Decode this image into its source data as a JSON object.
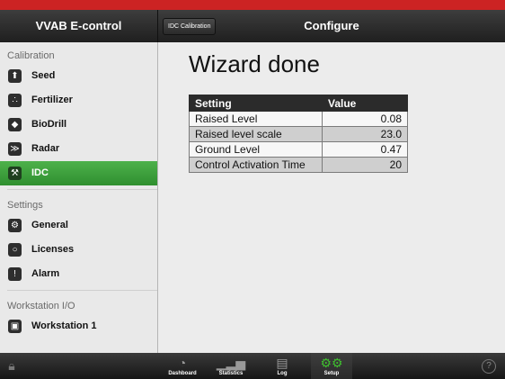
{
  "header": {
    "app_title": "VVAB E-control",
    "back_button": "IDC Calibration",
    "page_title": "Configure"
  },
  "sidebar": {
    "sections": [
      {
        "title": "Calibration",
        "items": [
          {
            "label": "Seed",
            "icon": "seed-icon",
            "active": false
          },
          {
            "label": "Fertilizer",
            "icon": "fertilizer-icon",
            "active": false
          },
          {
            "label": "BioDrill",
            "icon": "biodrill-icon",
            "active": false
          },
          {
            "label": "Radar",
            "icon": "radar-icon",
            "active": false
          },
          {
            "label": "IDC",
            "icon": "idc-icon",
            "active": true
          }
        ]
      },
      {
        "title": "Settings",
        "items": [
          {
            "label": "General",
            "icon": "general-icon",
            "active": false
          },
          {
            "label": "Licenses",
            "icon": "licenses-icon",
            "active": false
          },
          {
            "label": "Alarm",
            "icon": "alarm-icon",
            "active": false
          }
        ]
      },
      {
        "title": "Workstation I/O",
        "items": [
          {
            "label": "Workstation 1",
            "icon": "workstation-icon",
            "active": false
          }
        ]
      }
    ]
  },
  "main": {
    "heading": "Wizard done",
    "table": {
      "columns": [
        "Setting",
        "Value"
      ],
      "rows": [
        {
          "setting": "Raised Level",
          "value": "0.08"
        },
        {
          "setting": "Raised level scale",
          "value": "23.0"
        },
        {
          "setting": "Ground Level",
          "value": "0.47"
        },
        {
          "setting": "Control Activation Time",
          "value": "20"
        }
      ]
    }
  },
  "bottombar": {
    "tabs": [
      {
        "label": "Dashboard",
        "icon": "dashboard-gauge-icon",
        "active": false
      },
      {
        "label": "Statistics",
        "icon": "statistics-chart-icon",
        "active": false
      },
      {
        "label": "Log",
        "icon": "log-document-icon",
        "active": false
      },
      {
        "label": "Setup",
        "icon": "setup-gears-icon",
        "active": true
      }
    ],
    "help_glyph": "?"
  },
  "colors": {
    "brand_red": "#cc2323",
    "active_green": "#3a9d37",
    "topbar_dark": "#2a2a2a"
  }
}
